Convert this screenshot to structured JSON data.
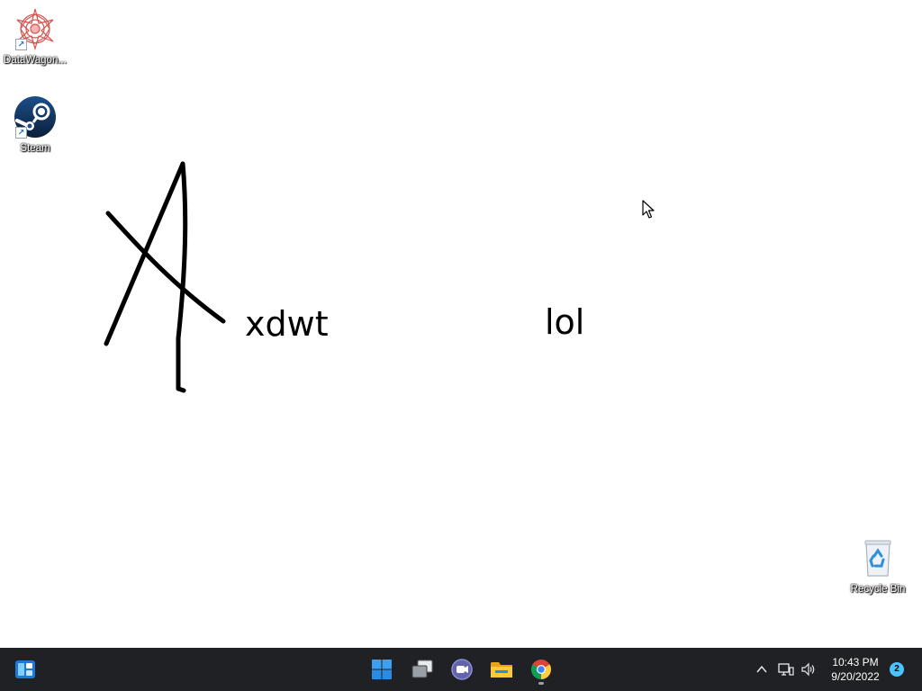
{
  "desktop": {
    "icons": [
      {
        "label": "DataWagon...",
        "icon": "datawagon-mandala-icon"
      },
      {
        "label": "Steam",
        "icon": "steam-icon"
      },
      {
        "label": "Recycle Bin",
        "icon": "recycle-bin-icon"
      }
    ],
    "texts": {
      "word1": "xdwt",
      "word2": "lol"
    },
    "drawing": "handdrawn-letter-A"
  },
  "taskbar": {
    "left_widget": "widgets-icon",
    "center_apps": [
      {
        "name": "Start",
        "icon": "windows-start-icon"
      },
      {
        "name": "Task View",
        "icon": "task-view-icon"
      },
      {
        "name": "Chat",
        "icon": "teams-chat-icon"
      },
      {
        "name": "File Explorer",
        "icon": "file-explorer-icon"
      },
      {
        "name": "Google Chrome",
        "icon": "chrome-icon",
        "active": true
      }
    ],
    "tray": {
      "time": "10:43 PM",
      "date": "9/20/2022",
      "notifications": "2"
    }
  },
  "colors": {
    "taskbar_bg": "#202124",
    "desktop_bg": "#ffffff",
    "accent": "#4cc2ff"
  }
}
